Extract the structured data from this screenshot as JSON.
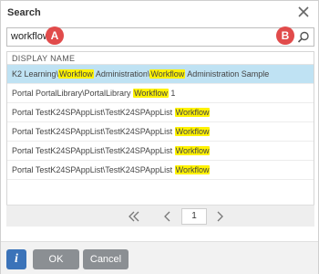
{
  "dialog": {
    "title": "Search"
  },
  "search": {
    "value": "workflow"
  },
  "badges": {
    "a": "A",
    "b": "B"
  },
  "table": {
    "header": "DISPLAY NAME",
    "rows": [
      {
        "parts": [
          {
            "t": "K2 Learning\\",
            "h": false
          },
          {
            "t": "Workflow",
            "h": true
          },
          {
            "t": " Administration\\",
            "h": false
          },
          {
            "t": "Workflow",
            "h": true
          },
          {
            "t": " Administration Sample",
            "h": false
          }
        ],
        "selected": true
      },
      {
        "parts": [
          {
            "t": "Portal PortalLibrary\\PortalLibrary ",
            "h": false
          },
          {
            "t": "Workflow",
            "h": true
          },
          {
            "t": " 1",
            "h": false
          }
        ],
        "selected": false
      },
      {
        "parts": [
          {
            "t": "Portal TestK24SPAppList\\TestK24SPAppList ",
            "h": false
          },
          {
            "t": "Workflow",
            "h": true
          }
        ],
        "selected": false
      },
      {
        "parts": [
          {
            "t": "Portal TestK24SPAppList\\TestK24SPAppList ",
            "h": false
          },
          {
            "t": "Workflow",
            "h": true
          }
        ],
        "selected": false
      },
      {
        "parts": [
          {
            "t": "Portal TestK24SPAppList\\TestK24SPAppList ",
            "h": false
          },
          {
            "t": "Workflow",
            "h": true
          }
        ],
        "selected": false
      },
      {
        "parts": [
          {
            "t": "Portal TestK24SPAppList\\TestK24SPAppList ",
            "h": false
          },
          {
            "t": "Workflow",
            "h": true
          }
        ],
        "selected": false
      }
    ]
  },
  "pager": {
    "page": "1"
  },
  "footer": {
    "info": "i",
    "ok": "OK",
    "cancel": "Cancel"
  },
  "colors": {
    "selected_row": "#bfe2f3",
    "highlight": "#fff200",
    "badge": "#e14b4b",
    "info_button": "#3b73b9",
    "button": "#8b8f93"
  },
  "icons": [
    "close-icon",
    "search-icon",
    "first-page-icon",
    "previous-page-icon",
    "next-page-icon",
    "info-icon"
  ]
}
